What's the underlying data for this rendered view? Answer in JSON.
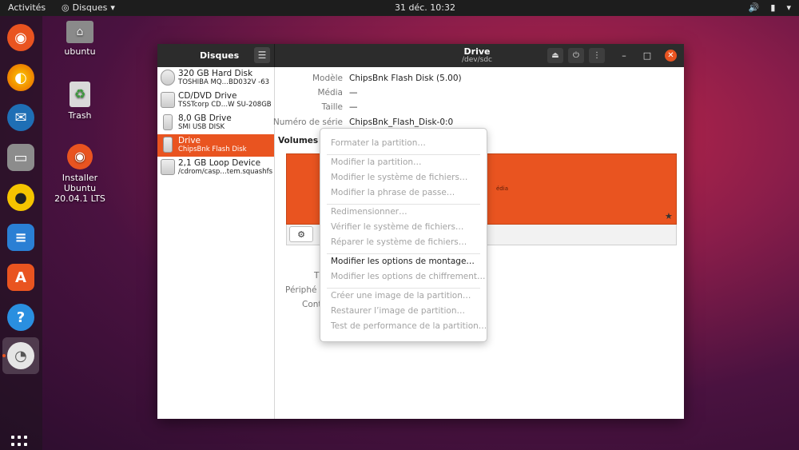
{
  "topbar": {
    "activities": "Activités",
    "app_name": "Disques",
    "clock": "31 déc.  10:32"
  },
  "desktop": {
    "icons": [
      {
        "label": "ubuntu"
      },
      {
        "label": "Trash"
      },
      {
        "label": "Installer Ubuntu 20.04.1 LTS"
      }
    ]
  },
  "window": {
    "sidebar_title": "Disques",
    "title": "Drive",
    "subtitle": "/dev/sdc"
  },
  "sidebar": {
    "disks": [
      {
        "name": "320 GB Hard Disk",
        "desc": "TOSHIBA MQ…BD032V -63"
      },
      {
        "name": "CD/DVD Drive",
        "desc": "TSSTcorp CD…W SU-208GB"
      },
      {
        "name": "8,0 GB Drive",
        "desc": "SMI USB DISK"
      },
      {
        "name": "Drive",
        "desc": "ChipsBnk Flash Disk",
        "selected": true
      },
      {
        "name": "2,1 GB Loop Device",
        "desc": "/cdrom/casp…tem.squashfs"
      }
    ]
  },
  "details": {
    "model_label": "Modèle",
    "model_value": "ChipsBnk Flash Disk (5.00)",
    "media_label": "Média",
    "media_value": "—",
    "size_label": "Taille",
    "size_value": "—",
    "serial_label": "Numéro de série",
    "serial_value": "ChipsBnk_Flash_Disk-0:0",
    "volumes_label": "Volumes",
    "volume_bar_text": "édia",
    "partial_labels": [
      "T",
      "Périphé",
      "Cont"
    ]
  },
  "menu": {
    "items": [
      {
        "label": "Formater la partition…",
        "enabled": false
      },
      {
        "label": "Modifier la partition…",
        "enabled": false
      },
      {
        "label": "Modifier le système de fichiers…",
        "enabled": false
      },
      {
        "label": "Modifier la phrase de passe…",
        "enabled": false
      },
      {
        "label": "Redimensionner…",
        "enabled": false
      },
      {
        "label": "Vérifier le système de fichiers…",
        "enabled": false
      },
      {
        "label": "Réparer le système de fichiers…",
        "enabled": false
      },
      {
        "label": "Modifier les options de montage…",
        "enabled": true
      },
      {
        "label": "Modifier les options de chiffrement…",
        "enabled": false
      },
      {
        "label": "Créer une image de la partition…",
        "enabled": false
      },
      {
        "label": "Restaurer l’image de partition…",
        "enabled": false
      },
      {
        "label": "Test de performance de la partition…",
        "enabled": false
      }
    ]
  },
  "colors": {
    "accent": "#e95420",
    "titlebar": "#2c2c2c",
    "disabled_text": "#a3a3a3"
  }
}
